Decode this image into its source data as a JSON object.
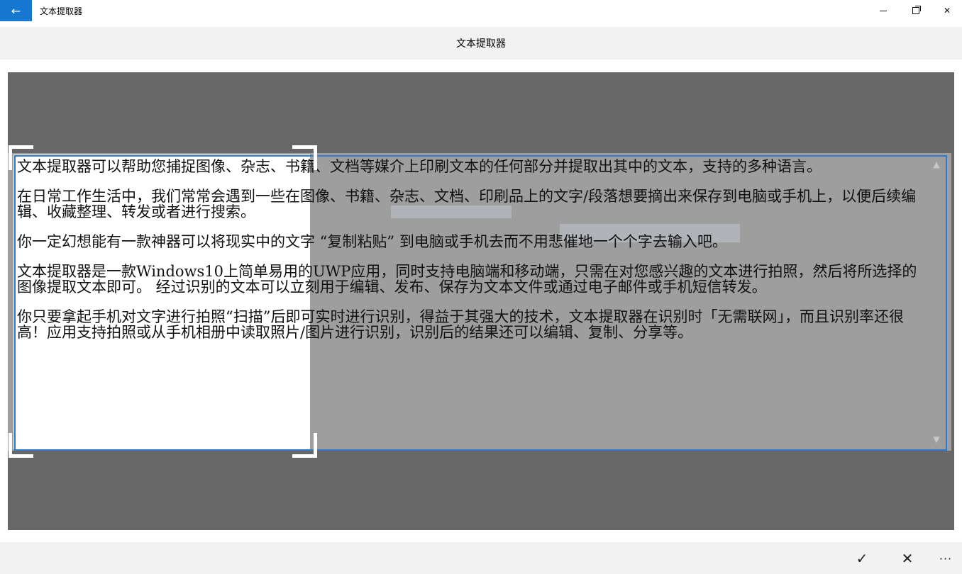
{
  "window": {
    "title": "文本提取器",
    "back_icon": "←",
    "minimize_icon": "minimize-icon",
    "maximize_icon": "restore-icon",
    "close_icon": "✕"
  },
  "header": {
    "title": "文本提取器"
  },
  "capture": {
    "paragraphs": [
      "文本提取器可以帮助您捕捉图像、杂志、书籍、文档等媒介上印刷文本的任何部分并提取出其中的文本，支持的多种语言。",
      "在日常工作生活中，我们常常会遇到一些在图像、书籍、杂志、文档、印刷品上的文字/段落想要摘出来保存到电脑或手机上，以便后续编辑、收藏整理、转发或者进行搜索。",
      "你一定幻想能有一款神器可以将现实中的文字 “复制粘贴” 到电脑或手机去而不用悲催地一个个字去输入吧。",
      "文本提取器是一款Windows10上简单易用的UWP应用，同时支持电脑端和移动端，只需在对您感兴趣的文本进行拍照，然后将所选择的图像提取文本即可。 经过识别的文本可以立刻用于编辑、发布、保存为文本文件或通过电子邮件或手机短信转发。",
      "你只要拿起手机对文字进行拍照“扫描”后即可实时进行识别，得益于其强大的技术，文本提取器在识别时「无需联网」，而且识别率还很高！应用支持拍照或从手机相册中读取照片/图片进行识别，识别后的结果还可以编辑、复制、分享等。"
    ],
    "scroll_up_icon": "▲",
    "scroll_down_icon": "▼"
  },
  "bottombar": {
    "accept_icon": "✓",
    "cancel_icon": "✕",
    "more_icon": "···"
  },
  "colors": {
    "accent": "#1778d1",
    "capture_bg": "#676767",
    "selection_border": "#2e7bd0"
  }
}
